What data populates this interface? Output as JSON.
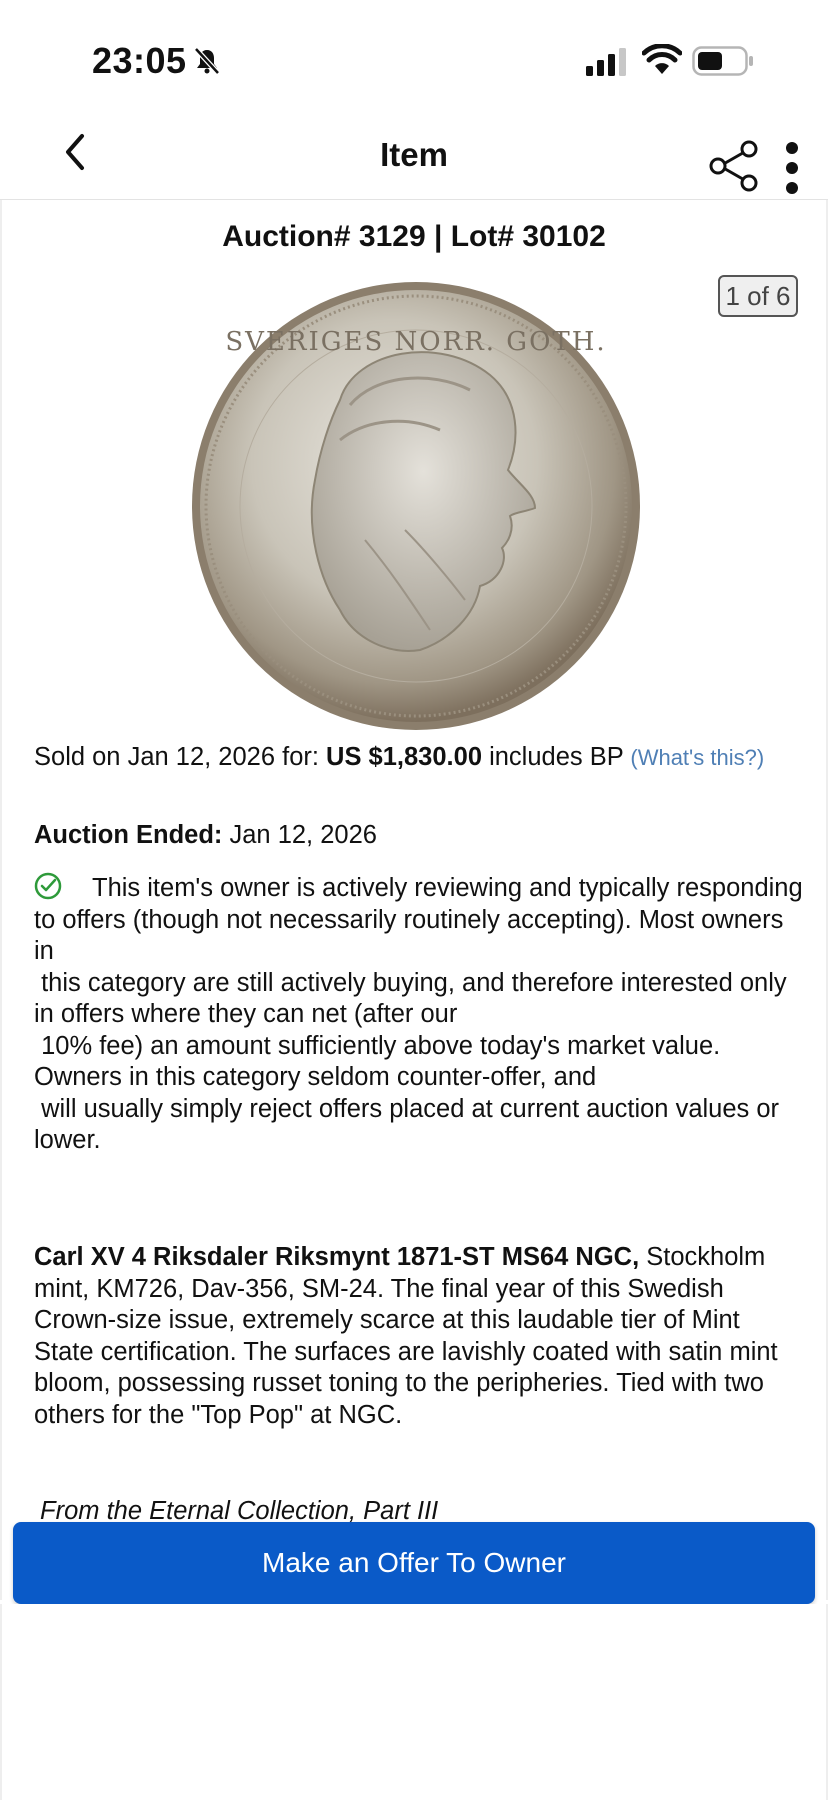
{
  "status_bar": {
    "time": "23:05",
    "icons": [
      "bell-slash-icon",
      "signal-icon",
      "wifi-icon",
      "battery-icon"
    ]
  },
  "nav": {
    "title": "Item",
    "back_icon": "chevron-left-icon",
    "share_icon": "share-icon",
    "more_icon": "more-vertical-icon"
  },
  "lot": {
    "title": "Auction# 3129 | Lot# 30102",
    "image_counter": "1 of 6"
  },
  "sale": {
    "sold_prefix": "Sold on Jan 12, 2026 for: ",
    "price": "US $1,830.00",
    "sold_suffix": " includes BP ",
    "whats_this": "(What's this?)",
    "ended_label": "Auction Ended:",
    "ended_value": " Jan 12, 2026"
  },
  "owner_notice": {
    "icon": "check-circle-icon",
    "text": "This item's owner is actively reviewing and typically responding to offers (though not necessarily routinely accepting). Most owners in\n this category are still actively buying, and therefore interested only in offers where they can net (after our\n 10% fee) an amount sufficiently above today's market value. Owners in this category seldom counter-offer, and\n will usually simply reject offers placed at current auction values or lower."
  },
  "description": {
    "title": "Carl XV 4 Riksdaler Riksmynt 1871-ST MS64 NGC,",
    "body": " Stockholm mint, KM726, Dav-356, SM-24. The final year of this Swedish Crown-size issue, extremely scarce at this laudable tier of Mint State certification. The surfaces are lavishly coated with satin mint bloom, possessing russet toning to the peripheries. Tied with two others for the \"Top Pop\" at NGC.",
    "provenance": "From the Eternal Collection, Part III"
  },
  "action": {
    "offer_button": "Make an Offer To Owner"
  },
  "colors": {
    "primary_button": "#0a5ac8",
    "link": "#4f7fb5",
    "success": "#2e9a3a"
  }
}
